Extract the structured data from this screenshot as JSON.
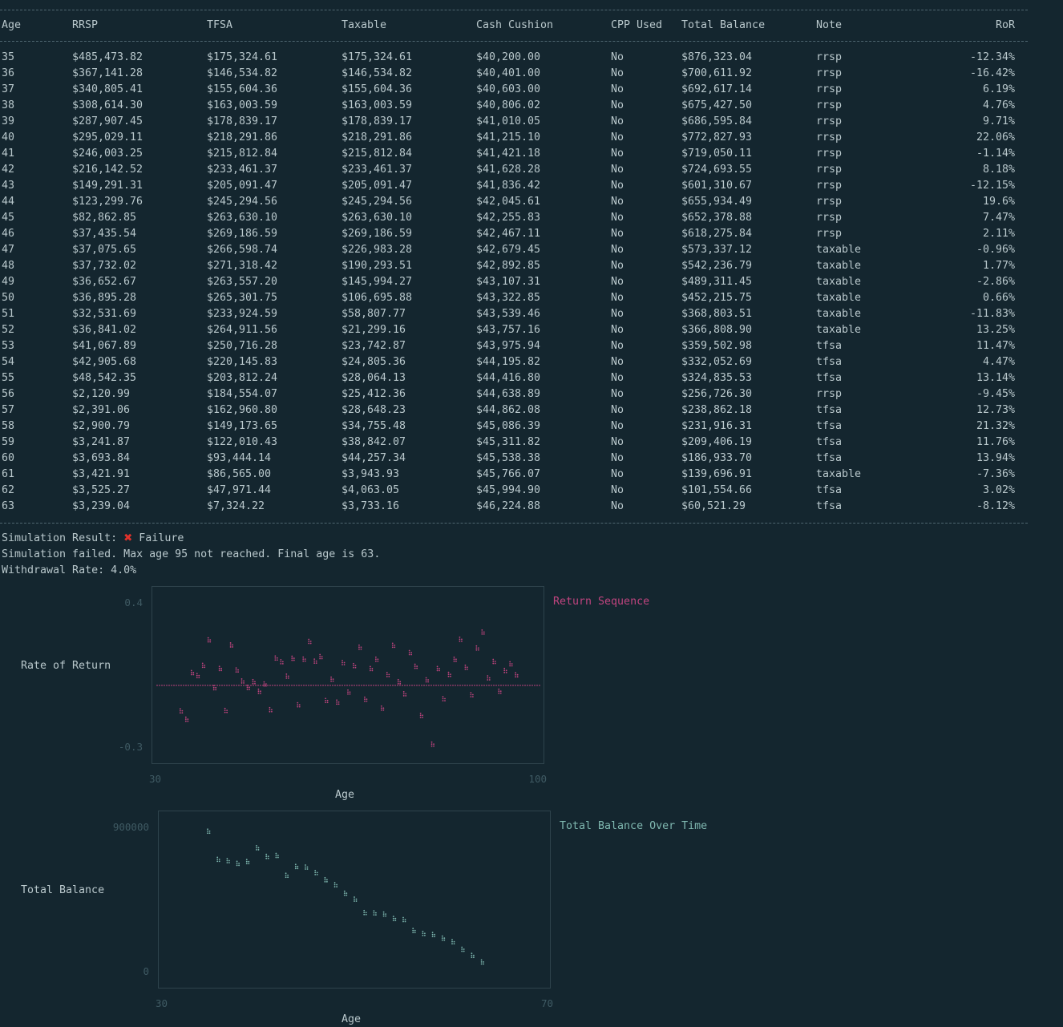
{
  "table": {
    "headers": [
      "Age",
      "RRSP",
      "TFSA",
      "Taxable",
      "Cash Cushion",
      "CPP Used",
      "Total Balance",
      "Note",
      "RoR"
    ],
    "rows": [
      [
        "35",
        "$485,473.82",
        "$175,324.61",
        "$175,324.61",
        "$40,200.00",
        "No",
        "$876,323.04",
        "rrsp",
        "-12.34%"
      ],
      [
        "36",
        "$367,141.28",
        "$146,534.82",
        "$146,534.82",
        "$40,401.00",
        "No",
        "$700,611.92",
        "rrsp",
        "-16.42%"
      ],
      [
        "37",
        "$340,805.41",
        "$155,604.36",
        "$155,604.36",
        "$40,603.00",
        "No",
        "$692,617.14",
        "rrsp",
        "6.19%"
      ],
      [
        "38",
        "$308,614.30",
        "$163,003.59",
        "$163,003.59",
        "$40,806.02",
        "No",
        "$675,427.50",
        "rrsp",
        "4.76%"
      ],
      [
        "39",
        "$287,907.45",
        "$178,839.17",
        "$178,839.17",
        "$41,010.05",
        "No",
        "$686,595.84",
        "rrsp",
        "9.71%"
      ],
      [
        "40",
        "$295,029.11",
        "$218,291.86",
        "$218,291.86",
        "$41,215.10",
        "No",
        "$772,827.93",
        "rrsp",
        "22.06%"
      ],
      [
        "41",
        "$246,003.25",
        "$215,812.84",
        "$215,812.84",
        "$41,421.18",
        "No",
        "$719,050.11",
        "rrsp",
        "-1.14%"
      ],
      [
        "42",
        "$216,142.52",
        "$233,461.37",
        "$233,461.37",
        "$41,628.28",
        "No",
        "$724,693.55",
        "rrsp",
        "8.18%"
      ],
      [
        "43",
        "$149,291.31",
        "$205,091.47",
        "$205,091.47",
        "$41,836.42",
        "No",
        "$601,310.67",
        "rrsp",
        "-12.15%"
      ],
      [
        "44",
        "$123,299.76",
        "$245,294.56",
        "$245,294.56",
        "$42,045.61",
        "No",
        "$655,934.49",
        "rrsp",
        "19.6%"
      ],
      [
        "45",
        "$82,862.85",
        "$263,630.10",
        "$263,630.10",
        "$42,255.83",
        "No",
        "$652,378.88",
        "rrsp",
        "7.47%"
      ],
      [
        "46",
        "$37,435.54",
        "$269,186.59",
        "$269,186.59",
        "$42,467.11",
        "No",
        "$618,275.84",
        "rrsp",
        "2.11%"
      ],
      [
        "47",
        "$37,075.65",
        "$266,598.74",
        "$226,983.28",
        "$42,679.45",
        "No",
        "$573,337.12",
        "taxable",
        "-0.96%"
      ],
      [
        "48",
        "$37,732.02",
        "$271,318.42",
        "$190,293.51",
        "$42,892.85",
        "No",
        "$542,236.79",
        "taxable",
        "1.77%"
      ],
      [
        "49",
        "$36,652.67",
        "$263,557.20",
        "$145,994.27",
        "$43,107.31",
        "No",
        "$489,311.45",
        "taxable",
        "-2.86%"
      ],
      [
        "50",
        "$36,895.28",
        "$265,301.75",
        "$106,695.88",
        "$43,322.85",
        "No",
        "$452,215.75",
        "taxable",
        "0.66%"
      ],
      [
        "51",
        "$32,531.69",
        "$233,924.59",
        "$58,807.77",
        "$43,539.46",
        "No",
        "$368,803.51",
        "taxable",
        "-11.83%"
      ],
      [
        "52",
        "$36,841.02",
        "$264,911.56",
        "$21,299.16",
        "$43,757.16",
        "No",
        "$366,808.90",
        "taxable",
        "13.25%"
      ],
      [
        "53",
        "$41,067.89",
        "$250,716.28",
        "$23,742.87",
        "$43,975.94",
        "No",
        "$359,502.98",
        "tfsa",
        "11.47%"
      ],
      [
        "54",
        "$42,905.68",
        "$220,145.83",
        "$24,805.36",
        "$44,195.82",
        "No",
        "$332,052.69",
        "tfsa",
        "4.47%"
      ],
      [
        "55",
        "$48,542.35",
        "$203,812.24",
        "$28,064.13",
        "$44,416.80",
        "No",
        "$324,835.53",
        "tfsa",
        "13.14%"
      ],
      [
        "56",
        "$2,120.99",
        "$184,554.07",
        "$25,412.36",
        "$44,638.89",
        "No",
        "$256,726.30",
        "rrsp",
        "-9.45%"
      ],
      [
        "57",
        "$2,391.06",
        "$162,960.80",
        "$28,648.23",
        "$44,862.08",
        "No",
        "$238,862.18",
        "tfsa",
        "12.73%"
      ],
      [
        "58",
        "$2,900.79",
        "$149,173.65",
        "$34,755.48",
        "$45,086.39",
        "No",
        "$231,916.31",
        "tfsa",
        "21.32%"
      ],
      [
        "59",
        "$3,241.87",
        "$122,010.43",
        "$38,842.07",
        "$45,311.82",
        "No",
        "$209,406.19",
        "tfsa",
        "11.76%"
      ],
      [
        "60",
        "$3,693.84",
        "$93,444.14",
        "$44,257.34",
        "$45,538.38",
        "No",
        "$186,933.70",
        "tfsa",
        "13.94%"
      ],
      [
        "61",
        "$3,421.91",
        "$86,565.00",
        "$3,943.93",
        "$45,766.07",
        "No",
        "$139,696.91",
        "taxable",
        "-7.36%"
      ],
      [
        "62",
        "$3,525.27",
        "$47,971.44",
        "$4,063.05",
        "$45,994.90",
        "No",
        "$101,554.66",
        "tfsa",
        "3.02%"
      ],
      [
        "63",
        "$3,239.04",
        "$7,324.22",
        "$3,733.16",
        "$46,224.88",
        "No",
        "$60,521.29",
        "tfsa",
        "-8.12%"
      ]
    ]
  },
  "summary": {
    "result_label": "Simulation Result:",
    "result_icon": "x-mark-icon",
    "result_value": "Failure",
    "message": "Simulation failed. Max age 95 not reached. Final age is 63.",
    "withdrawal_rate": "Withdrawal Rate: 4.0%"
  },
  "colors": {
    "background": "#14262f",
    "text": "#b9c8cc",
    "ror_series": "#c0447f",
    "balance_series": "#7fb8b0",
    "failure_icon": "#e0322b"
  },
  "chart_data": [
    {
      "type": "scatter",
      "legend": "Return Sequence",
      "ylabel": "Rate of Return",
      "xlabel": "Age",
      "xlim": [
        30,
        100
      ],
      "ylim": [
        -0.3,
        0.4
      ],
      "x_tick_labels": [
        "30",
        "100"
      ],
      "y_tick_labels": [
        "0.4",
        "-0.3"
      ],
      "series": [
        {
          "name": "Return Sequence",
          "x": [
            35,
            36,
            37,
            38,
            39,
            40,
            41,
            42,
            43,
            44,
            45,
            46,
            47,
            48,
            49,
            50,
            51,
            52,
            53,
            54,
            55,
            56,
            57,
            58,
            59,
            60,
            61,
            62,
            63,
            64,
            65,
            66,
            67,
            68,
            69,
            70,
            71,
            72,
            73,
            74,
            75,
            76,
            77,
            78,
            79,
            80,
            81,
            82,
            83,
            84,
            85,
            86,
            87,
            88,
            89,
            90,
            91,
            92,
            93,
            94,
            95
          ],
          "y": [
            -0.1234,
            -0.1642,
            0.0619,
            0.0476,
            0.0971,
            0.2206,
            -0.0114,
            0.0818,
            -0.1215,
            0.196,
            0.0747,
            0.0211,
            -0.0096,
            0.0177,
            -0.0286,
            0.0066,
            -0.1183,
            0.1325,
            0.1147,
            0.0447,
            0.1314,
            -0.0945,
            0.1273,
            0.2132,
            0.1176,
            0.1394,
            -0.0736,
            0.0302,
            -0.0812,
            0.1102,
            -0.0325,
            0.0958,
            0.1851,
            -0.0672,
            0.0814,
            0.1267,
            -0.1104,
            0.0523,
            0.1945,
            0.0176,
            -0.0409,
            0.1588,
            0.0925,
            -0.1453,
            0.0267,
            -0.2851,
            0.0814,
            -0.0648,
            0.0532,
            0.1265,
            0.2234,
            0.0877,
            -0.0453,
            0.1812,
            0.2586,
            0.0364,
            0.1159,
            -0.0283,
            0.0721,
            0.1044,
            0.0512
          ]
        }
      ]
    },
    {
      "type": "scatter",
      "legend": "Total Balance Over Time",
      "ylabel": "Total Balance",
      "xlabel": "Age",
      "xlim": [
        30,
        70
      ],
      "ylim": [
        0,
        900000
      ],
      "x_tick_labels": [
        "30",
        "70"
      ],
      "y_tick_labels": [
        "900000",
        "0"
      ],
      "series": [
        {
          "name": "Total Balance Over Time",
          "x": [
            35,
            36,
            37,
            38,
            39,
            40,
            41,
            42,
            43,
            44,
            45,
            46,
            47,
            48,
            49,
            50,
            51,
            52,
            53,
            54,
            55,
            56,
            57,
            58,
            59,
            60,
            61,
            62,
            63
          ],
          "y": [
            876323.04,
            700611.92,
            692617.14,
            675427.5,
            686595.84,
            772827.93,
            719050.11,
            724693.55,
            601310.67,
            655934.49,
            652378.88,
            618275.84,
            573337.12,
            542236.79,
            489311.45,
            452215.75,
            368803.51,
            366808.9,
            359502.98,
            332052.69,
            324835.53,
            256726.3,
            238862.18,
            231916.31,
            209406.19,
            186933.7,
            139696.91,
            101554.66,
            60521.29
          ]
        }
      ]
    }
  ]
}
